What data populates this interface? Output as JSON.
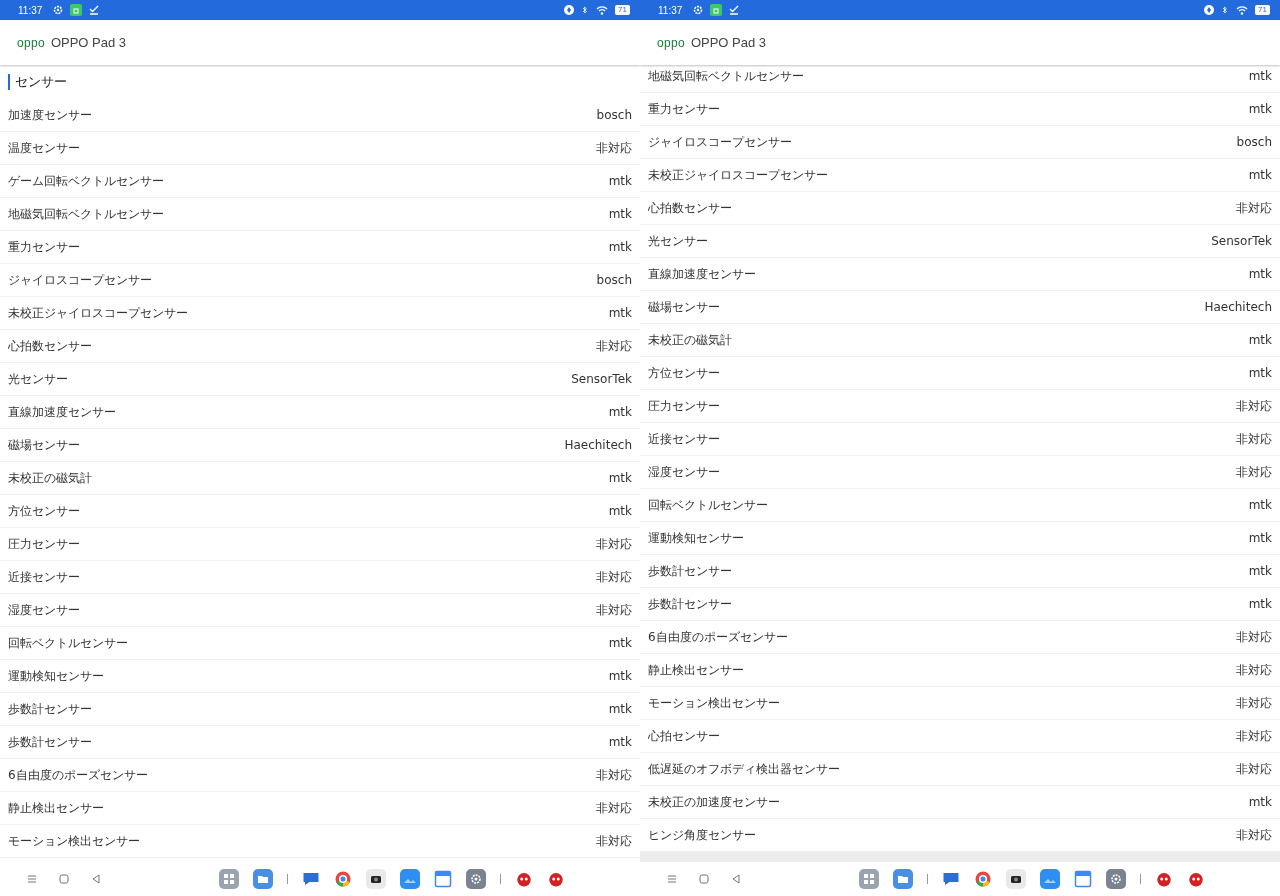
{
  "screens": [
    {
      "status_bar": {
        "time": "11:37",
        "battery": "71"
      },
      "app_bar": {
        "logo": "oppo",
        "title": "OPPO Pad 3"
      },
      "section_title": "センサー",
      "rows": [
        {
          "name": "加速度センサー",
          "value": "bosch"
        },
        {
          "name": "温度センサー",
          "value": "非対応"
        },
        {
          "name": "ゲーム回転ベクトルセンサー",
          "value": "mtk"
        },
        {
          "name": "地磁気回転ベクトルセンサー",
          "value": "mtk"
        },
        {
          "name": "重力センサー",
          "value": "mtk"
        },
        {
          "name": "ジャイロスコープセンサー",
          "value": "bosch"
        },
        {
          "name": "未校正ジャイロスコープセンサー",
          "value": "mtk"
        },
        {
          "name": "心拍数センサー",
          "value": "非対応"
        },
        {
          "name": "光センサー",
          "value": "SensorTek"
        },
        {
          "name": "直線加速度センサー",
          "value": "mtk"
        },
        {
          "name": "磁場センサー",
          "value": "Haechitech"
        },
        {
          "name": "未校正の磁気計",
          "value": "mtk"
        },
        {
          "name": "方位センサー",
          "value": "mtk"
        },
        {
          "name": "圧力センサー",
          "value": "非対応"
        },
        {
          "name": "近接センサー",
          "value": "非対応"
        },
        {
          "name": "湿度センサー",
          "value": "非対応"
        },
        {
          "name": "回転ベクトルセンサー",
          "value": "mtk"
        },
        {
          "name": "運動検知センサー",
          "value": "mtk"
        },
        {
          "name": "歩数計センサー",
          "value": "mtk"
        },
        {
          "name": "歩数計センサー",
          "value": "mtk"
        },
        {
          "name": "6自由度のポーズセンサー",
          "value": "非対応"
        },
        {
          "name": "静止検出センサー",
          "value": "非対応"
        },
        {
          "name": "モーション検出センサー",
          "value": "非対応"
        }
      ]
    },
    {
      "status_bar": {
        "time": "11:37",
        "battery": "71"
      },
      "app_bar": {
        "logo": "oppo",
        "title": "OPPO Pad 3"
      },
      "list_end": true,
      "rows": [
        {
          "name": "地磁気回転ベクトルセンサー",
          "value": "mtk"
        },
        {
          "name": "重力センサー",
          "value": "mtk"
        },
        {
          "name": "ジャイロスコープセンサー",
          "value": "bosch"
        },
        {
          "name": "未校正ジャイロスコープセンサー",
          "value": "mtk"
        },
        {
          "name": "心拍数センサー",
          "value": "非対応"
        },
        {
          "name": "光センサー",
          "value": "SensorTek"
        },
        {
          "name": "直線加速度センサー",
          "value": "mtk"
        },
        {
          "name": "磁場センサー",
          "value": "Haechitech"
        },
        {
          "name": "未校正の磁気計",
          "value": "mtk"
        },
        {
          "name": "方位センサー",
          "value": "mtk"
        },
        {
          "name": "圧力センサー",
          "value": "非対応"
        },
        {
          "name": "近接センサー",
          "value": "非対応"
        },
        {
          "name": "湿度センサー",
          "value": "非対応"
        },
        {
          "name": "回転ベクトルセンサー",
          "value": "mtk"
        },
        {
          "name": "運動検知センサー",
          "value": "mtk"
        },
        {
          "name": "歩数計センサー",
          "value": "mtk"
        },
        {
          "name": "歩数計センサー",
          "value": "mtk"
        },
        {
          "name": "6自由度のポーズセンサー",
          "value": "非対応"
        },
        {
          "name": "静止検出センサー",
          "value": "非対応"
        },
        {
          "name": "モーション検出センサー",
          "value": "非対応"
        },
        {
          "name": "心拍センサー",
          "value": "非対応"
        },
        {
          "name": "低遅延のオフボディ検出器センサー",
          "value": "非対応"
        },
        {
          "name": "未校正の加速度センサー",
          "value": "mtk"
        },
        {
          "name": "ヒンジ角度センサー",
          "value": "非対応"
        }
      ]
    }
  ]
}
